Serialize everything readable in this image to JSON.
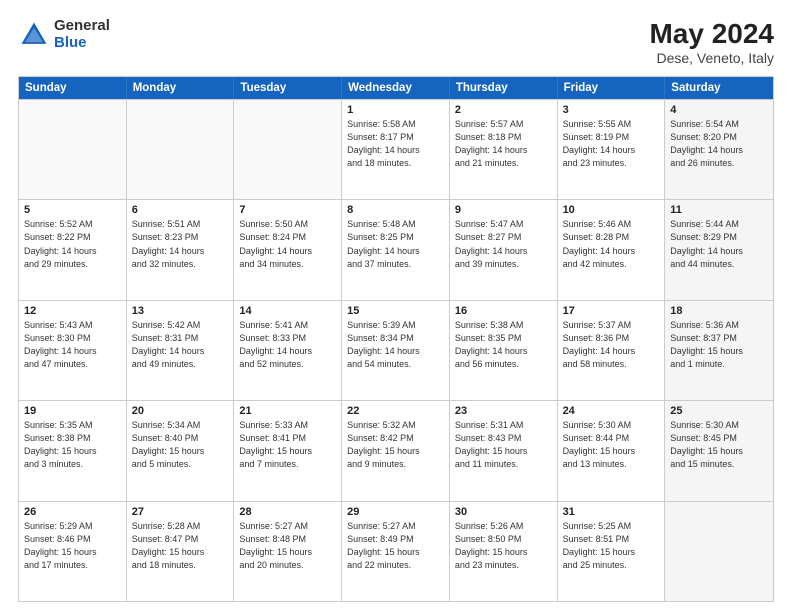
{
  "logo": {
    "general": "General",
    "blue": "Blue"
  },
  "title": "May 2024",
  "subtitle": "Dese, Veneto, Italy",
  "headers": [
    "Sunday",
    "Monday",
    "Tuesday",
    "Wednesday",
    "Thursday",
    "Friday",
    "Saturday"
  ],
  "weeks": [
    [
      {
        "day": "",
        "info": "",
        "empty": true
      },
      {
        "day": "",
        "info": "",
        "empty": true
      },
      {
        "day": "",
        "info": "",
        "empty": true
      },
      {
        "day": "1",
        "info": "Sunrise: 5:58 AM\nSunset: 8:17 PM\nDaylight: 14 hours\nand 18 minutes."
      },
      {
        "day": "2",
        "info": "Sunrise: 5:57 AM\nSunset: 8:18 PM\nDaylight: 14 hours\nand 21 minutes."
      },
      {
        "day": "3",
        "info": "Sunrise: 5:55 AM\nSunset: 8:19 PM\nDaylight: 14 hours\nand 23 minutes."
      },
      {
        "day": "4",
        "info": "Sunrise: 5:54 AM\nSunset: 8:20 PM\nDaylight: 14 hours\nand 26 minutes.",
        "shaded": true
      }
    ],
    [
      {
        "day": "5",
        "info": "Sunrise: 5:52 AM\nSunset: 8:22 PM\nDaylight: 14 hours\nand 29 minutes."
      },
      {
        "day": "6",
        "info": "Sunrise: 5:51 AM\nSunset: 8:23 PM\nDaylight: 14 hours\nand 32 minutes."
      },
      {
        "day": "7",
        "info": "Sunrise: 5:50 AM\nSunset: 8:24 PM\nDaylight: 14 hours\nand 34 minutes."
      },
      {
        "day": "8",
        "info": "Sunrise: 5:48 AM\nSunset: 8:25 PM\nDaylight: 14 hours\nand 37 minutes."
      },
      {
        "day": "9",
        "info": "Sunrise: 5:47 AM\nSunset: 8:27 PM\nDaylight: 14 hours\nand 39 minutes."
      },
      {
        "day": "10",
        "info": "Sunrise: 5:46 AM\nSunset: 8:28 PM\nDaylight: 14 hours\nand 42 minutes."
      },
      {
        "day": "11",
        "info": "Sunrise: 5:44 AM\nSunset: 8:29 PM\nDaylight: 14 hours\nand 44 minutes.",
        "shaded": true
      }
    ],
    [
      {
        "day": "12",
        "info": "Sunrise: 5:43 AM\nSunset: 8:30 PM\nDaylight: 14 hours\nand 47 minutes."
      },
      {
        "day": "13",
        "info": "Sunrise: 5:42 AM\nSunset: 8:31 PM\nDaylight: 14 hours\nand 49 minutes."
      },
      {
        "day": "14",
        "info": "Sunrise: 5:41 AM\nSunset: 8:33 PM\nDaylight: 14 hours\nand 52 minutes."
      },
      {
        "day": "15",
        "info": "Sunrise: 5:39 AM\nSunset: 8:34 PM\nDaylight: 14 hours\nand 54 minutes."
      },
      {
        "day": "16",
        "info": "Sunrise: 5:38 AM\nSunset: 8:35 PM\nDaylight: 14 hours\nand 56 minutes."
      },
      {
        "day": "17",
        "info": "Sunrise: 5:37 AM\nSunset: 8:36 PM\nDaylight: 14 hours\nand 58 minutes."
      },
      {
        "day": "18",
        "info": "Sunrise: 5:36 AM\nSunset: 8:37 PM\nDaylight: 15 hours\nand 1 minute.",
        "shaded": true
      }
    ],
    [
      {
        "day": "19",
        "info": "Sunrise: 5:35 AM\nSunset: 8:38 PM\nDaylight: 15 hours\nand 3 minutes."
      },
      {
        "day": "20",
        "info": "Sunrise: 5:34 AM\nSunset: 8:40 PM\nDaylight: 15 hours\nand 5 minutes."
      },
      {
        "day": "21",
        "info": "Sunrise: 5:33 AM\nSunset: 8:41 PM\nDaylight: 15 hours\nand 7 minutes."
      },
      {
        "day": "22",
        "info": "Sunrise: 5:32 AM\nSunset: 8:42 PM\nDaylight: 15 hours\nand 9 minutes."
      },
      {
        "day": "23",
        "info": "Sunrise: 5:31 AM\nSunset: 8:43 PM\nDaylight: 15 hours\nand 11 minutes."
      },
      {
        "day": "24",
        "info": "Sunrise: 5:30 AM\nSunset: 8:44 PM\nDaylight: 15 hours\nand 13 minutes."
      },
      {
        "day": "25",
        "info": "Sunrise: 5:30 AM\nSunset: 8:45 PM\nDaylight: 15 hours\nand 15 minutes.",
        "shaded": true
      }
    ],
    [
      {
        "day": "26",
        "info": "Sunrise: 5:29 AM\nSunset: 8:46 PM\nDaylight: 15 hours\nand 17 minutes."
      },
      {
        "day": "27",
        "info": "Sunrise: 5:28 AM\nSunset: 8:47 PM\nDaylight: 15 hours\nand 18 minutes."
      },
      {
        "day": "28",
        "info": "Sunrise: 5:27 AM\nSunset: 8:48 PM\nDaylight: 15 hours\nand 20 minutes."
      },
      {
        "day": "29",
        "info": "Sunrise: 5:27 AM\nSunset: 8:49 PM\nDaylight: 15 hours\nand 22 minutes."
      },
      {
        "day": "30",
        "info": "Sunrise: 5:26 AM\nSunset: 8:50 PM\nDaylight: 15 hours\nand 23 minutes."
      },
      {
        "day": "31",
        "info": "Sunrise: 5:25 AM\nSunset: 8:51 PM\nDaylight: 15 hours\nand 25 minutes."
      },
      {
        "day": "",
        "info": "",
        "empty": true,
        "shaded": true
      }
    ]
  ]
}
